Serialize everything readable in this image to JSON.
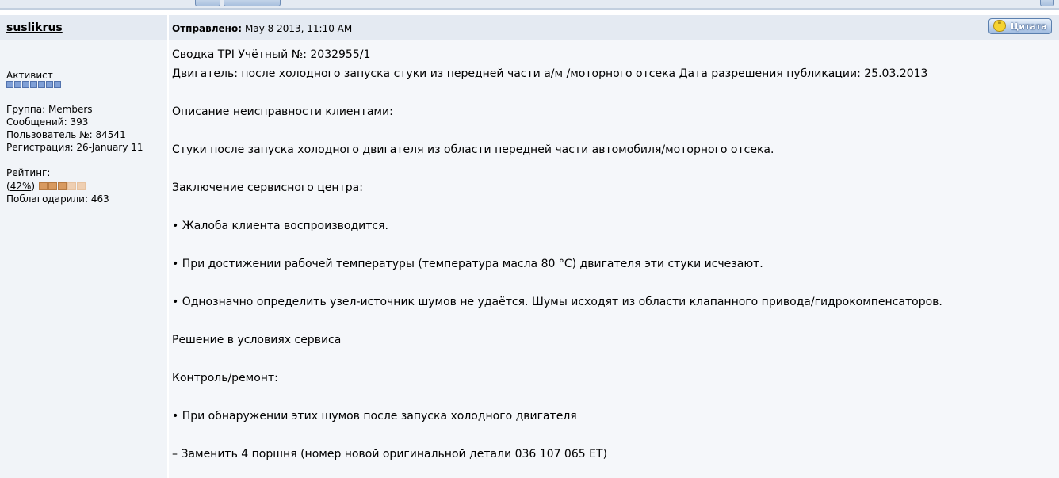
{
  "author": {
    "name": "suslikrus",
    "title": "Активист",
    "group": "Группа: Members",
    "posts": "Сообщений: 393",
    "user_no": "Пользователь №: 84541",
    "registered": "Регистрация: 26-January 11",
    "rating_label": "Рейтинг:",
    "rating_open": "(",
    "rating_pct": "42%",
    "rating_close": ")",
    "rating_value": 0.42,
    "thanks": "Поблагодарили: 463"
  },
  "post": {
    "posted_label": "Отправлено:",
    "posted_date": "May 8 2013, 11:10 AM",
    "quote_label": "Цитата",
    "lines": [
      "Сводка TPI Учётный №: 2032955/1",
      "Двигатель: после холодного запуска стуки из передней части а/м /моторного отсека Дата разрешения публикации: 25.03.2013",
      "",
      "Описание неисправности клиентами:",
      "",
      "Стуки после запуска холодного двигателя из области передней части автомобиля/моторного отсека.",
      "",
      "Заключение сервисного центра:",
      "",
      "• Жалоба клиента воспроизводится.",
      "",
      "• При достижении рабочей температуры (температура масла 80 °C) двигателя эти стуки исчезают.",
      "",
      "• Однозначно определить узел-источник шумов не удаётся. Шумы исходят из области клапанного привода/гидрокомпенсаторов.",
      "",
      "Решение в условиях сервиса",
      "",
      "Контроль/ремонт:",
      "",
      "• При обнаружении этих шумов после запуска холодного двигателя",
      "",
      "– Заменить 4 поршня (номер новой оригинальной детали 036 107 065 ET)"
    ]
  },
  "colors": {
    "header_bg": "#e4eaf2",
    "left_bg": "#f1f4f8",
    "right_bg": "#f5f7fa",
    "pip": "#7f9fd6",
    "rating_on": "#d89a60",
    "rating_off": "#efcfb2"
  }
}
